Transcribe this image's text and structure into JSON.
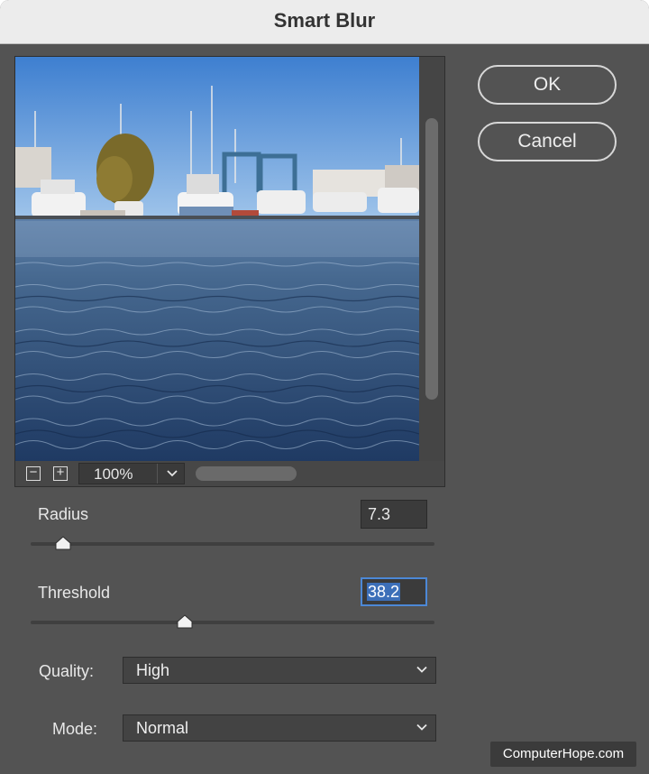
{
  "dialog": {
    "title": "Smart Blur"
  },
  "buttons": {
    "ok": "OK",
    "cancel": "Cancel"
  },
  "preview": {
    "zoom_out_glyph": "−",
    "zoom_in_glyph": "+",
    "zoom_value": "100%"
  },
  "radius": {
    "label": "Radius",
    "value": "7.3",
    "slider_fraction": 0.08
  },
  "threshold": {
    "label": "Threshold",
    "value": "38.2",
    "slider_fraction": 0.382
  },
  "quality": {
    "label": "Quality:",
    "value": "High"
  },
  "mode": {
    "label": "Mode:",
    "value": "Normal"
  },
  "watermark": "ComputerHope.com",
  "icons": {
    "zoom_out": "minus-icon",
    "zoom_in": "plus-icon",
    "dropdown": "chevron-down-icon"
  },
  "colors": {
    "dialog_bg": "#535353",
    "focus_ring": "#4c88d6",
    "selection": "#3c6fb8"
  }
}
